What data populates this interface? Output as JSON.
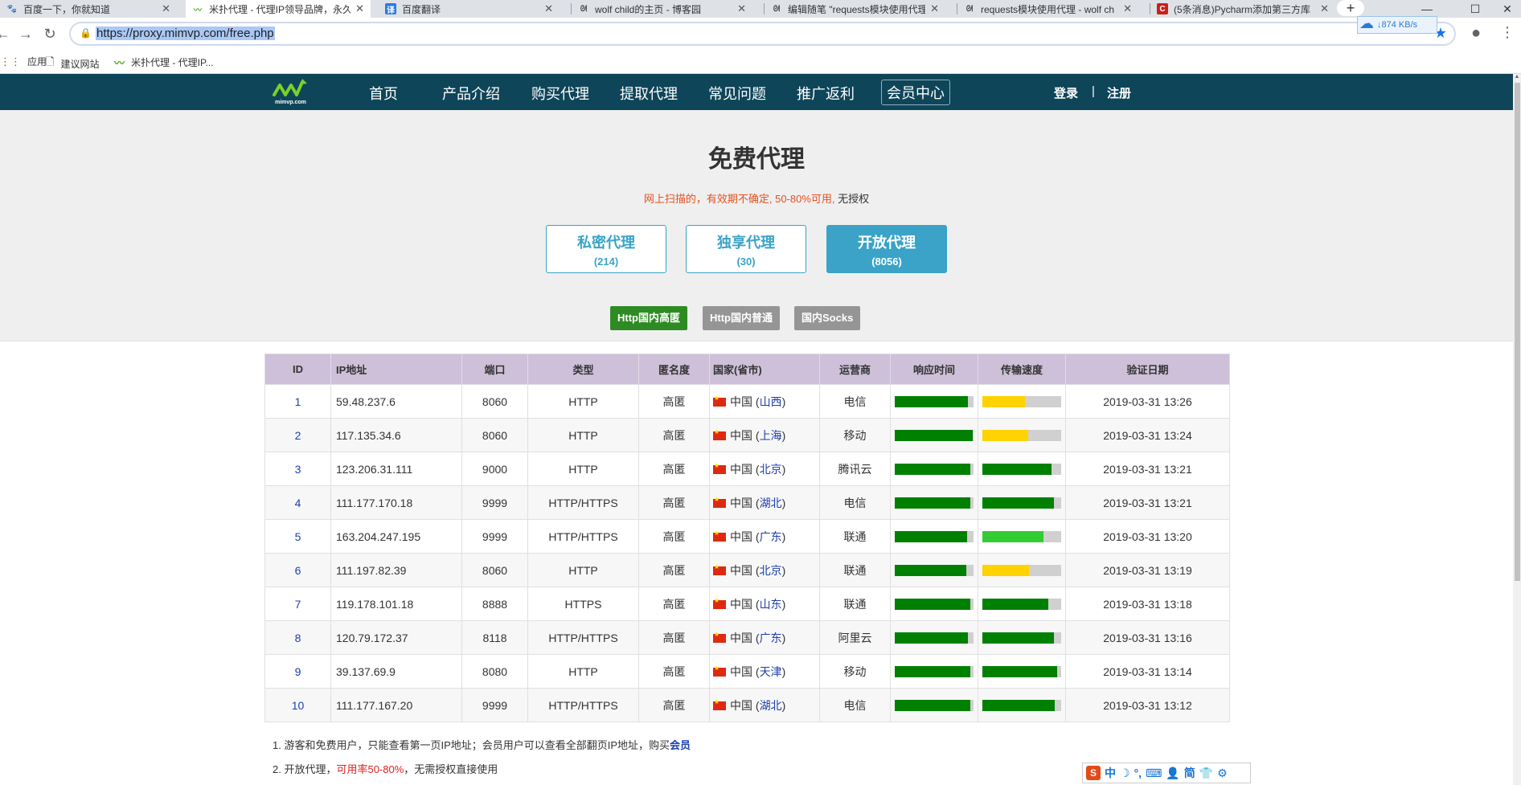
{
  "browser": {
    "tabs": [
      {
        "label": "百度一下，你就知道",
        "icon": "baidu-paw-icon",
        "active": false
      },
      {
        "label": "米扑代理 - 代理IP领导品牌，永久",
        "icon": "mimvp-logo-icon",
        "active": true
      },
      {
        "label": "百度翻译",
        "icon": "baidu-translate-icon",
        "active": false
      },
      {
        "label": "wolf child的主页 - 博客园",
        "icon": "cnblogs-icon",
        "active": false
      },
      {
        "label": "编辑随笔 \"requests模块使用代理",
        "icon": "cnblogs-icon",
        "active": false
      },
      {
        "label": "requests模块使用代理 - wolf ch",
        "icon": "cnblogs-icon",
        "active": false
      },
      {
        "label": "(5条消息)Pycharm添加第三方库",
        "icon": "csdn-icon",
        "active": false
      }
    ],
    "url": "https://proxy.mimvp.com/free.php",
    "speed_widget": "↓874 KB/s",
    "bookmarks": [
      {
        "label": "应用",
        "icon": "apps-grid-icon"
      },
      {
        "label": "建议网站",
        "icon": "page-icon"
      },
      {
        "label": "米扑代理 - 代理IP...",
        "icon": "mimvp-logo-icon"
      }
    ]
  },
  "site": {
    "logo_text": "mimvp.com",
    "nav": [
      "首页",
      "产品介绍",
      "购买代理",
      "提取代理",
      "常见问题",
      "推广返利",
      "会员中心"
    ],
    "login": "登录",
    "sep": "|",
    "register": "注册"
  },
  "hero": {
    "title": "免费代理",
    "subtitle_warn": "网上扫描的，有效期不确定, 50-80%可用,",
    "subtitle_plain": " 无授权",
    "boxes": [
      {
        "name": "私密代理",
        "count": "(214)",
        "active": false
      },
      {
        "name": "独享代理",
        "count": "(30)",
        "active": false
      },
      {
        "name": "开放代理",
        "count": "(8056)",
        "active": true
      }
    ],
    "filters": [
      {
        "label": "Http国内高匿",
        "active": true
      },
      {
        "label": "Http国内普通",
        "active": false
      },
      {
        "label": "国内Socks",
        "active": false
      }
    ]
  },
  "table": {
    "headers": [
      "ID",
      "IP地址",
      "端口",
      "类型",
      "匿名度",
      "国家(省市)",
      "运营商",
      "响应时间",
      "传输速度",
      "验证日期"
    ],
    "rows": [
      {
        "id": "1",
        "ip": "59.48.237.6",
        "port": "8060",
        "type": "HTTP",
        "anon": "高匿",
        "country": "中国",
        "province": "山西",
        "isp": "电信",
        "resp": 0.93,
        "resp_color": "#008000",
        "speed": 0.54,
        "speed_color": "#ffd200",
        "date": "2019-03-31 13:26"
      },
      {
        "id": "2",
        "ip": "117.135.34.6",
        "port": "8060",
        "type": "HTTP",
        "anon": "高匿",
        "country": "中国",
        "province": "上海",
        "isp": "移动",
        "resp": 0.99,
        "resp_color": "#008000",
        "speed": 0.58,
        "speed_color": "#ffd200",
        "date": "2019-03-31 13:24"
      },
      {
        "id": "3",
        "ip": "123.206.31.111",
        "port": "9000",
        "type": "HTTP",
        "anon": "高匿",
        "country": "中国",
        "province": "北京",
        "isp": "腾讯云",
        "resp": 0.96,
        "resp_color": "#008000",
        "speed": 0.88,
        "speed_color": "#008000",
        "date": "2019-03-31 13:21"
      },
      {
        "id": "4",
        "ip": "111.177.170.18",
        "port": "9999",
        "type": "HTTP/HTTPS",
        "anon": "高匿",
        "country": "中国",
        "province": "湖北",
        "isp": "电信",
        "resp": 0.96,
        "resp_color": "#008000",
        "speed": 0.91,
        "speed_color": "#008000",
        "date": "2019-03-31 13:21"
      },
      {
        "id": "5",
        "ip": "163.204.247.195",
        "port": "9999",
        "type": "HTTP/HTTPS",
        "anon": "高匿",
        "country": "中国",
        "province": "广东",
        "isp": "联通",
        "resp": 0.92,
        "resp_color": "#008000",
        "speed": 0.78,
        "speed_color": "#33cc33",
        "date": "2019-03-31 13:20"
      },
      {
        "id": "6",
        "ip": "111.197.82.39",
        "port": "8060",
        "type": "HTTP",
        "anon": "高匿",
        "country": "中国",
        "province": "北京",
        "isp": "联通",
        "resp": 0.91,
        "resp_color": "#008000",
        "speed": 0.59,
        "speed_color": "#ffd200",
        "date": "2019-03-31 13:19"
      },
      {
        "id": "7",
        "ip": "119.178.101.18",
        "port": "8888",
        "type": "HTTPS",
        "anon": "高匿",
        "country": "中国",
        "province": "山东",
        "isp": "联通",
        "resp": 0.96,
        "resp_color": "#008000",
        "speed": 0.84,
        "speed_color": "#008000",
        "date": "2019-03-31 13:18"
      },
      {
        "id": "8",
        "ip": "120.79.172.37",
        "port": "8118",
        "type": "HTTP/HTTPS",
        "anon": "高匿",
        "country": "中国",
        "province": "广东",
        "isp": "阿里云",
        "resp": 0.93,
        "resp_color": "#008000",
        "speed": 0.91,
        "speed_color": "#008000",
        "date": "2019-03-31 13:16"
      },
      {
        "id": "9",
        "ip": "39.137.69.9",
        "port": "8080",
        "type": "HTTP",
        "anon": "高匿",
        "country": "中国",
        "province": "天津",
        "isp": "移动",
        "resp": 0.96,
        "resp_color": "#008000",
        "speed": 0.95,
        "speed_color": "#008000",
        "date": "2019-03-31 13:14"
      },
      {
        "id": "10",
        "ip": "111.177.167.20",
        "port": "9999",
        "type": "HTTP/HTTPS",
        "anon": "高匿",
        "country": "中国",
        "province": "湖北",
        "isp": "电信",
        "resp": 0.96,
        "resp_color": "#008000",
        "speed": 0.92,
        "speed_color": "#008000",
        "date": "2019-03-31 13:12"
      }
    ]
  },
  "notes": {
    "line1_text": "1. 游客和免费用户，只能查看第一页IP地址；会员用户可以查看全部翻页IP地址，购买",
    "line1_link": "会员",
    "line2_prefix": "2. 开放代理，",
    "line2_red": "可用率50-80%",
    "line2_suffix": "，无需授权直接使用"
  },
  "ime": [
    "中",
    "简"
  ]
}
